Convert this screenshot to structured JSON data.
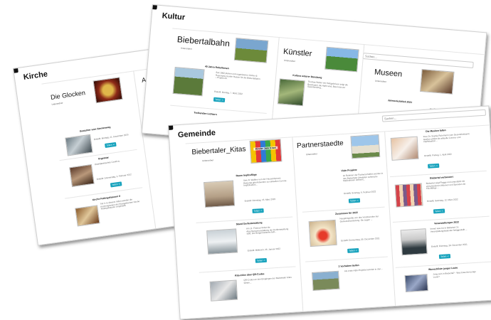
{
  "share_label": "Teilen ≺",
  "search_placeholder": "Suchen...",
  "kirche": {
    "title": "Kirche",
    "col1": {
      "title": "Die Glocken",
      "sub": "Unterordner"
    },
    "col2_title": "And",
    "entries": [
      {
        "title": "Besichter vom Sternenweg",
        "date": "Erstellt: Montag, 21. Dezember 2020"
      },
      {
        "title": "Orgelstar",
        "text": "Osterlateinisches Covid-zu",
        "date": "Erstellt: Donnerstag, 3. Februar 2022"
      },
      {
        "title": "Kirche Fettingshausen II",
        "text": "Teil 3: In diesem Video werden die Kirchenglocken der Evangelischen Kirche Fettingshausen vorgestellt."
      }
    ]
  },
  "kultur": {
    "title": "Kultur",
    "cols": [
      {
        "title": "Biebertalbahn",
        "sub": "Unterordner",
        "entry": {
          "title": "40 Jahre Rebellionen",
          "text": "Seit 1982 planen und organisieren Günter & Rosemarie Kurthe Reisen für die Biebertalbahn – Projekt 20.",
          "date": "Erstellt: Montag, 7. März 2022"
        },
        "next_title": "Treibenden Lichtern"
      },
      {
        "title": "Künstler",
        "sub": "Unterordner",
        "entry": {
          "title": "Kultura unterer Dünsberg",
          "text": "Thomas Weber mit Holzgalerieen zeigt die Baumuster, die Apfel sind, Baum bis zur Sauerlandung..."
        }
      },
      {
        "title": "Museen",
        "sub": "Unterordner",
        "entry": {
          "title": "Jahresrückblick 2021",
          "text": "Ein Rückblick"
        }
      }
    ]
  },
  "gemeinde": {
    "title": "Gemeinde",
    "cols": [
      {
        "title": "Biebertaler_Kitas",
        "sub": "Unterordner",
        "logo": "Kinder Jahr Kitas",
        "entries": [
          {
            "title": "Raum Impfzuflüge",
            "text": "Uwe R. Walther von der Hausarztpraxis Biebertal gibt Antworten zur aktuellen Corona-Impfsituation...",
            "date": "Erstellt: Dienstag, 15. März 2022"
          },
          {
            "title": "Stand Dorfentwicklung",
            "text": "Am 11. Februar findet die Abschlussveranstaltung der Dorfentwicklung statt. Die Bürgermeisterin teilt...",
            "date": "Erstellt: Mittwoch, 26. Januar 2022"
          },
          {
            "title": "Kita-Infos über QR-Codes",
            "text": "QR-Codes an den Eingängen der Biebertaler Kitas bieten..."
          }
        ]
      },
      {
        "title": "Partnerstaedte",
        "sub": "Unterordner",
        "entries": [
          {
            "title": "Viele Projekte",
            "text": "Im Rahmen der Partnerschaften wurden in den Biebertaler Ortsteilen zahlreiche Maßnahmen definiert...",
            "date": "Erstellt: Sonntag, 6. Februar 2022"
          },
          {
            "title": "Zusammen für 2022",
            "text": "Neujahrsgrüße von den Vorsitzenden der Gemeindevertretung. Sie sagen ...",
            "date": "Erstellt: Donnerstag, 30. Dezember 2021"
          },
          {
            "title": "2 Vorhaben laufen",
            "text": "Als erste HEK-Projekte konnten in den..."
          }
        ]
      },
      {
        "title": "",
        "entries": [
          {
            "title": "Die Masken fallen",
            "text": "Frau Dr. Sophie Ruhrmann vom Gesundheitsamt Gießen erklärt die aktuelle Corona- und Impfsituation...",
            "date": "Erstellt: Freitag, 1. April 2022"
          },
          {
            "title": "Biebertal verbessert",
            "text": "Biebertal zeigt Flagge und unterstützt mit verschiedenen Aktionen und Spenden die Flüchtlinge ...",
            "date": "Erstellt: Samstag, 12. März 2022"
          },
          {
            "title": "Veranstaltungen 2022",
            "text": "Immer was los in Biebertal: 2x Veranstaltungskalender fertiggestellt ...",
            "date": "Erstellt: Dienstag, 28. Dezember 2021"
          },
          {
            "title": "Wunschliste junger Leute",
            "text": "Jung sein in Biebertal? - Was brauchen junge Leute?"
          }
        ]
      }
    ]
  }
}
